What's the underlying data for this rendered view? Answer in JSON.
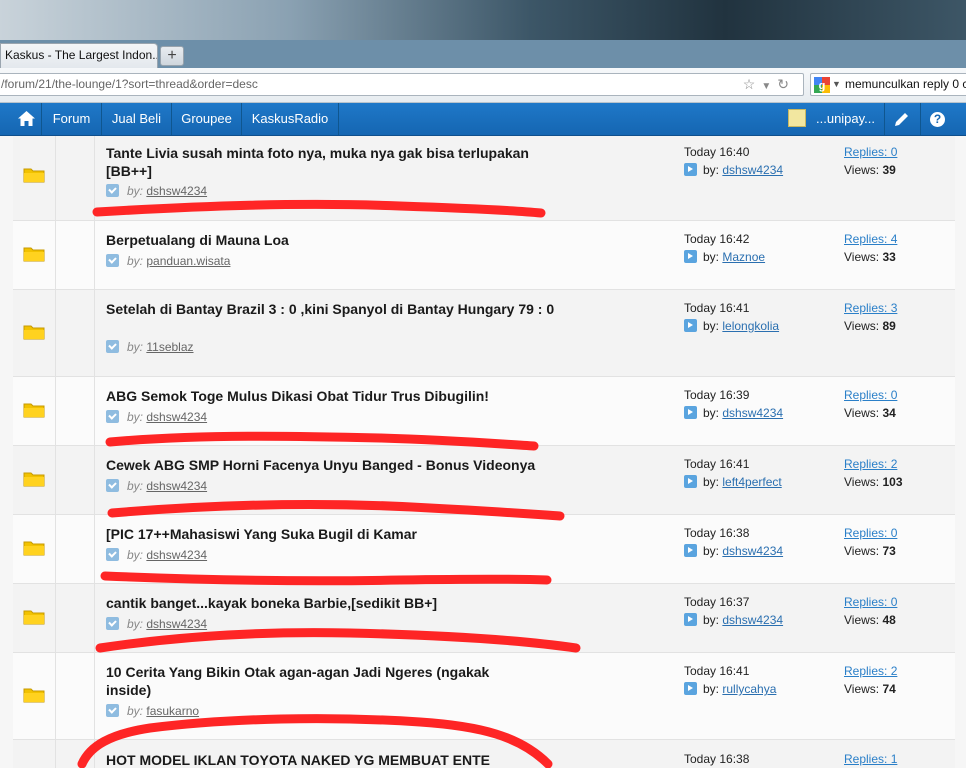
{
  "browser": {
    "tab_title": "Kaskus - The Largest Indon...",
    "new_tab_symbol": "+",
    "url": "/forum/21/the-lounge/1?sort=thread&order=desc",
    "search_text": "memunculkan reply 0 c"
  },
  "nav": {
    "items": [
      "Forum",
      "Jual Beli",
      "Groupee",
      "KaskusRadio"
    ],
    "user": "...unipay...",
    "help_symbol": "?"
  },
  "threads": [
    {
      "title": "Tante Livia susah minta foto nya, muka nya gak bisa terlupakan [BB++]",
      "by": "by:",
      "author": "dshsw4234",
      "time": "Today 16:40",
      "last_by": "by:",
      "last_user": "dshsw4234",
      "replies": "Replies: 0",
      "views_label": "Views:",
      "views": "39"
    },
    {
      "title": "Berpetualang di Mauna Loa",
      "by": "by:",
      "author": "panduan.wisata",
      "time": "Today 16:42",
      "last_by": "by:",
      "last_user": "Maznoe",
      "replies": "Replies: 4",
      "views_label": "Views:",
      "views": "33"
    },
    {
      "title": "Setelah di Bantay Brazil 3 : 0 ,kini Spanyol di Bantay Hungary 79 : 0",
      "by": "by:",
      "author": "11seblaz",
      "time": "Today 16:41",
      "last_by": "by:",
      "last_user": "lelongkolia",
      "replies": "Replies: 3",
      "views_label": "Views:",
      "views": "89"
    },
    {
      "title": "ABG Semok Toge Mulus Dikasi Obat Tidur Trus Dibugilin!",
      "by": "by:",
      "author": "dshsw4234",
      "time": "Today 16:39",
      "last_by": "by:",
      "last_user": "dshsw4234",
      "replies": "Replies: 0",
      "views_label": "Views:",
      "views": "34"
    },
    {
      "title": "Cewek ABG SMP Horni Facenya Unyu Banged - Bonus Videonya",
      "by": "by:",
      "author": "dshsw4234",
      "time": "Today 16:41",
      "last_by": "by:",
      "last_user": "left4perfect",
      "replies": "Replies: 2",
      "views_label": "Views:",
      "views": "103"
    },
    {
      "title": "[PIC 17++Mahasiswi Yang Suka Bugil di Kamar",
      "by": "by:",
      "author": "dshsw4234",
      "time": "Today 16:38",
      "last_by": "by:",
      "last_user": "dshsw4234",
      "replies": "Replies: 0",
      "views_label": "Views:",
      "views": "73"
    },
    {
      "title": "cantik banget...kayak boneka Barbie,[sedikit BB+]",
      "by": "by:",
      "author": "dshsw4234",
      "time": "Today 16:37",
      "last_by": "by:",
      "last_user": "dshsw4234",
      "replies": "Replies: 0",
      "views_label": "Views:",
      "views": "48"
    },
    {
      "title": "10 Cerita Yang Bikin Otak agan-agan Jadi Ngeres (ngakak inside)",
      "by": "by:",
      "author": "fasukarno",
      "time": "Today 16:41",
      "last_by": "by:",
      "last_user": "rullycahya",
      "replies": "Replies: 2",
      "views_label": "Views:",
      "views": "74"
    },
    {
      "title": "HOT MODEL IKLAN TOYOTA NAKED YG MEMBUAT ENTE",
      "by": "",
      "author": "",
      "time": "Today 16:38",
      "last_by": "",
      "last_user": "",
      "replies": "Replies: 1",
      "views_label": "",
      "views": ""
    }
  ],
  "colors": {
    "nav_blue": "#1566b2",
    "link_blue": "#2a7fc8",
    "marker_red": "#ff1a1a"
  }
}
